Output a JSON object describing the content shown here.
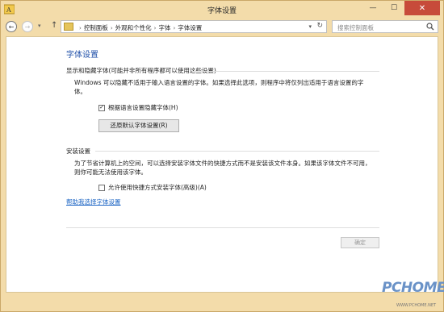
{
  "window": {
    "title": "字体设置",
    "buttons": {
      "minimize": "—",
      "maximize": "☐",
      "close": "✕"
    }
  },
  "nav": {
    "back": "←",
    "forward": "→",
    "history_dropdown": "▾",
    "up": "↑",
    "breadcrumb": [
      "控制面板",
      "外观和个性化",
      "字体",
      "字体设置"
    ],
    "crumb_separator": "›",
    "address_dropdown": "▾",
    "refresh": "↻",
    "search_placeholder": "搜索控制面板"
  },
  "main": {
    "heading": "字体设置",
    "section1": {
      "title": "显示和隐藏字体(可能并非所有程序都可以使用这些设置)",
      "description": "Windows 可以隐藏不适用于输入语言设置的字体。如果选择此选项，则程序中将仅列出适用于语言设置的字体。",
      "checkbox_label": "根据语言设置隐藏字体(H)",
      "checkbox_checked": true,
      "restore_button": "还原默认字体设置(R)"
    },
    "section2": {
      "title": "安装设置",
      "description": "为了节省计算机上的空间，可以选择安装字体文件的快捷方式而不是安装该文件本身。如果该字体文件不可用，则你可能无法使用该字体。",
      "checkbox_label": "允许使用快捷方式安装字体(高级)(A)",
      "checkbox_checked": false
    },
    "help_link": "帮助我选择字体设置",
    "ok_button": "确定"
  },
  "watermark": {
    "brand": "PCHOME",
    "url": "WWW.PCHOME.NET"
  },
  "colors": {
    "window_frame": "#f3dcaa",
    "heading": "#1f4fa8",
    "link": "#1c65c4",
    "close_button": "#c74b3a"
  }
}
